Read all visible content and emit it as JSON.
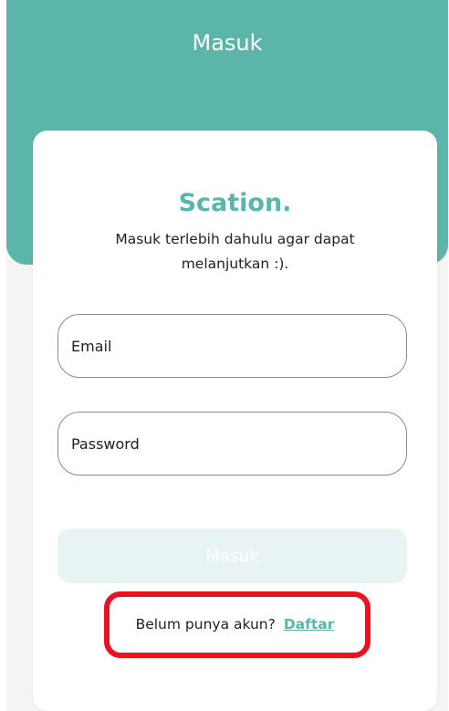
{
  "header": {
    "title": "Masuk"
  },
  "brand": {
    "name": "Scation."
  },
  "intro": {
    "text": "Masuk terlebih dahulu agar dapat melanjutkan :)."
  },
  "form": {
    "email_placeholder": "Email",
    "password_placeholder": "Password",
    "submit_label": "Masuk"
  },
  "register": {
    "prompt": "Belum punya akun?",
    "link_label": "Daftar"
  },
  "colors": {
    "accent": "#5bb5a8",
    "button_disabled_bg": "#e7f4f3",
    "annotation_red": "#e8131e"
  }
}
